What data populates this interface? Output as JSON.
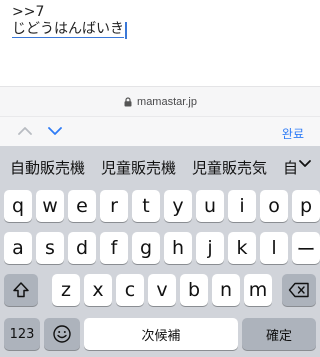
{
  "text_area": {
    "quote": ">>7",
    "compose": "じどうはんばいき"
  },
  "url_bar": {
    "domain": "mamastar.jp"
  },
  "accessory": {
    "done_label": "완료"
  },
  "candidates": [
    "自動販売機",
    "児童販売機",
    "児童販売気",
    "自"
  ],
  "keyboard": {
    "row1": [
      "q",
      "w",
      "e",
      "r",
      "t",
      "y",
      "u",
      "i",
      "o",
      "p"
    ],
    "row2": [
      "a",
      "s",
      "d",
      "f",
      "g",
      "h",
      "j",
      "k",
      "l",
      "ー"
    ],
    "row3": [
      "z",
      "x",
      "c",
      "v",
      "b",
      "n",
      "m"
    ],
    "numbers_label": "123",
    "space_label": "次候補",
    "return_label": "確定"
  },
  "colors": {
    "accent": "#3a78d8",
    "keyboard_bg": "#d1d4da",
    "key_bg": "#ffffff",
    "dark_key_bg": "#adb3bc"
  }
}
